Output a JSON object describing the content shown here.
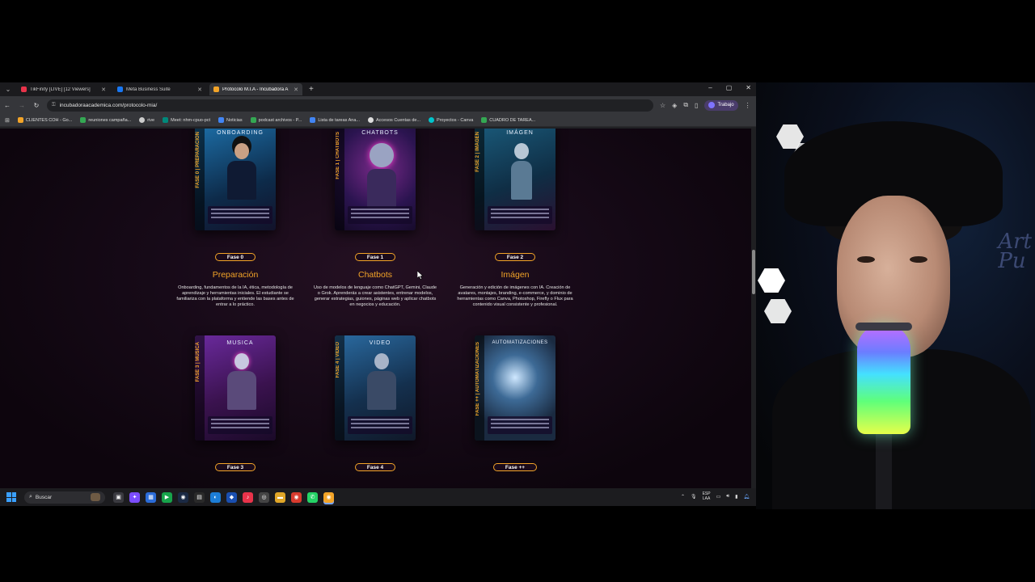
{
  "tabs": [
    {
      "title": "TikFinity [LIVE] [12 Viewers]",
      "color": "#e8334a",
      "active": false
    },
    {
      "title": "Meta Business Suite",
      "color": "#1877f2",
      "active": false
    },
    {
      "title": "Protocolo M.I.A - Incubadora A",
      "color": "#f3a428",
      "active": true
    }
  ],
  "window_controls": {
    "minimize": "–",
    "maximize": "▢",
    "close": "✕"
  },
  "address_bar": {
    "url": "incubadoraacademica.com/protocolo-mia/"
  },
  "profile": {
    "label": "Trabajo"
  },
  "bookmarks": [
    {
      "label": "CLIENTES COH - Go...",
      "color": "#f3a428"
    },
    {
      "label": "reuniones campaña...",
      "color": "#34a853"
    },
    {
      "label": "rive",
      "color": "#cccccc"
    },
    {
      "label": "Meet: nhm-cpuo-pct",
      "color": "#00897b"
    },
    {
      "label": "Noticias",
      "color": "#4285f4"
    },
    {
      "label": "podcast archivos - P...",
      "color": "#34a853"
    },
    {
      "label": "Lista de tareas Ana...",
      "color": "#4285f4"
    },
    {
      "label": "Accesos Cuentas de...",
      "color": "#dddddd"
    },
    {
      "label": "Proyectos - Canva",
      "color": "#00c4cc"
    },
    {
      "label": "CUADRO DE TAREA...",
      "color": "#34a853"
    }
  ],
  "phases": [
    {
      "badge": "Fase 0",
      "title": "Preparación",
      "cover_title": "ONBOARDING",
      "spine": "FASE 0 | PREPARACIÓN",
      "description": "Onboarding, fundamentos de la IA, ética, metodología de aprendizaje y herramientas iniciales. El estudiante se familiariza con la plataforma y entiende las bases antes de entrar a lo práctico.",
      "bg": "#1d6fa8",
      "accent": "#45d0ff"
    },
    {
      "badge": "Fase 1",
      "title": "Chatbots",
      "cover_title": "CHATBOTS",
      "spine": "FASE 1 | CHATBOTS",
      "description": "Uso de modelos de lenguaje como ChatGPT, Gemini, Claude o Grok. Aprenderás a crear asistentes, entrenar modelos, generar estrategias, guiones, páginas web y aplicar chatbots en negocios y educación.",
      "bg": "#2b1450",
      "accent": "#ff3fd0"
    },
    {
      "badge": "Fase 2",
      "title": "Imágen",
      "cover_title": "IMÁGEN",
      "spine": "FASE 2 | IMÁGEN",
      "description": "Generación y edición de imágenes con IA. Creación de avatares, montajes, branding, e-commerce, y dominio de herramientas como Canva, Photoshop, Firefly o Flux para contenido visual consistente y profesional.",
      "bg": "#1a5a7a",
      "accent": "#ff5c9a"
    },
    {
      "badge": "Fase 3",
      "cover_title": "MUSICA",
      "spine": "FASE 3 | MÚSICA",
      "bg": "#4a1a6e",
      "accent": "#ff4fc8"
    },
    {
      "badge": "Fase 4",
      "cover_title": "VIDEO",
      "spine": "FASE 4 | VIDEO",
      "bg": "#1c3f66",
      "accent": "#49b6ff"
    },
    {
      "badge": "Fase ++",
      "cover_title": "AUTOMATIZACIONES",
      "spine": "FASE ++ | AUTOMATIZACIONES",
      "bg": "#1f3550",
      "accent": "#9fd8ff"
    }
  ],
  "taskbar": {
    "search_placeholder": "Buscar",
    "lang_line1": "ESP",
    "lang_line2": "LAA",
    "apps": [
      {
        "name": "task-view",
        "color": "#3a3a40",
        "glyph": "▣"
      },
      {
        "name": "copilot",
        "color": "#7b4dff",
        "glyph": "✦"
      },
      {
        "name": "store",
        "color": "#2b6cd8",
        "glyph": "▦"
      },
      {
        "name": "play",
        "color": "#17a34a",
        "glyph": "▶"
      },
      {
        "name": "steam",
        "color": "#1b2a44",
        "glyph": "◉"
      },
      {
        "name": "terminal",
        "color": "#2a2a2a",
        "glyph": "▤"
      },
      {
        "name": "edge",
        "color": "#1c7dd6",
        "glyph": "◐"
      },
      {
        "name": "ps",
        "color": "#1a4fb0",
        "glyph": "◆"
      },
      {
        "name": "tiktok",
        "color": "#e8334a",
        "glyph": "♪"
      },
      {
        "name": "chrome-dev",
        "color": "#444",
        "glyph": "◎"
      },
      {
        "name": "explorer",
        "color": "#e0a628",
        "glyph": "▬"
      },
      {
        "name": "chrome",
        "color": "#d93b2e",
        "glyph": "◉"
      },
      {
        "name": "whatsapp",
        "color": "#25d366",
        "glyph": "✆"
      },
      {
        "name": "chrome-canary",
        "color": "#f3a428",
        "glyph": "◉"
      }
    ]
  }
}
